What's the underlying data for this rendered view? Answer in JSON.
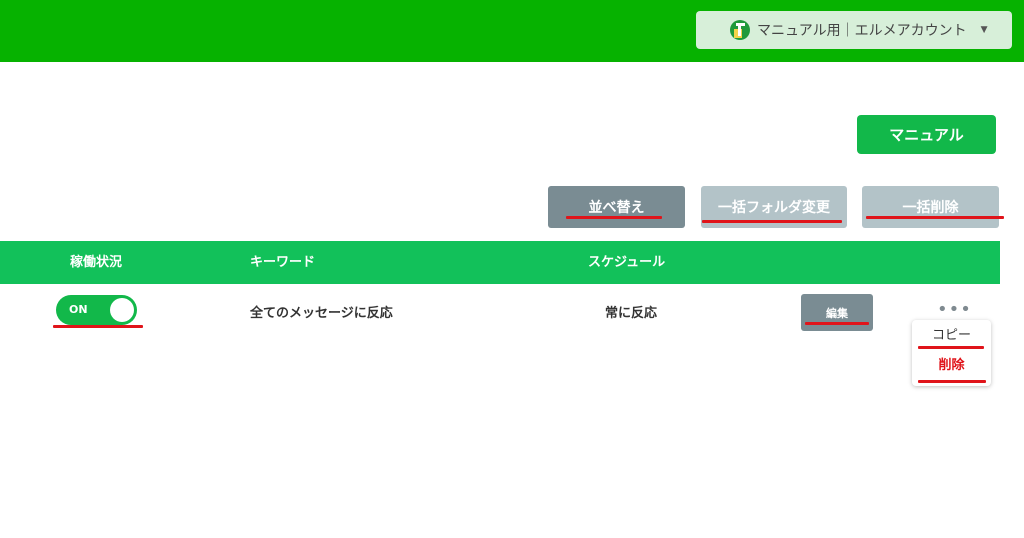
{
  "header": {
    "account_label": "マニュアル用｜エルメアカウント",
    "brand_color": "#06b200"
  },
  "toolbar": {
    "manual_label": "マニュアル",
    "sort_label": "並べ替え",
    "folder_change_label": "一括フォルダ変更",
    "bulk_delete_label": "一括削除"
  },
  "table": {
    "columns": [
      "稼働状況",
      "キーワード",
      "スケジュール"
    ],
    "rows": [
      {
        "status": "ON",
        "keyword": "全てのメッセージに反応",
        "schedule": "常に反応",
        "edit_label": "編集"
      }
    ]
  },
  "menu": {
    "items": [
      "コピー",
      "削除"
    ]
  },
  "colors": {
    "accent_green": "#12b84a",
    "header_green": "#06b200",
    "annotation_red": "#e0141a",
    "gray_button": "#7a8c93",
    "disabled_button": "#b3c3c8"
  }
}
